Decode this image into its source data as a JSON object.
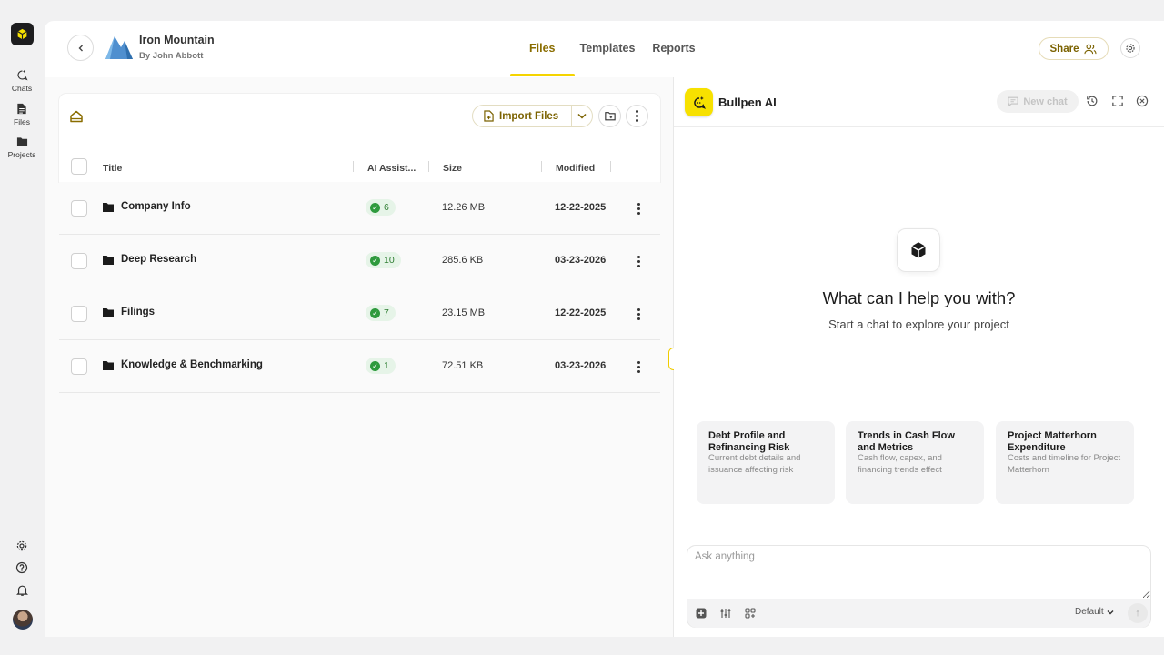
{
  "rail": {
    "items": [
      {
        "label": "Chats",
        "icon": "chat-sparkle-icon"
      },
      {
        "label": "Files",
        "icon": "file-icon"
      },
      {
        "label": "Projects",
        "icon": "folder-icon"
      }
    ],
    "bottom_icons": [
      "settings-icon",
      "help-icon",
      "bell-icon",
      "avatar"
    ]
  },
  "header": {
    "project_title": "Iron Mountain",
    "project_owner": "By John Abbott",
    "tabs": [
      {
        "label": "Files",
        "active": true
      },
      {
        "label": "Templates",
        "active": false
      },
      {
        "label": "Reports",
        "active": false
      }
    ],
    "share_label": "Share"
  },
  "files": {
    "import_label": "Import Files",
    "columns": {
      "title": "Title",
      "ai": "AI Assist...",
      "size": "Size",
      "modified": "Modified"
    },
    "rows": [
      {
        "name": "Company Info",
        "ai_count": "6",
        "size": "12.26 MB",
        "modified": "12-22-2025"
      },
      {
        "name": "Deep Research",
        "ai_count": "10",
        "size": "285.6 KB",
        "modified": "03-23-2026"
      },
      {
        "name": "Filings",
        "ai_count": "7",
        "size": "23.15 MB",
        "modified": "12-22-2025"
      },
      {
        "name": "Knowledge & Benchmarking",
        "ai_count": "1",
        "size": "72.51 KB",
        "modified": "03-23-2026"
      }
    ]
  },
  "ai": {
    "title": "Bullpen AI",
    "new_chat_label": "New chat",
    "hero_title": "What can I help you with?",
    "hero_subtitle": "Start a chat to explore your project",
    "suggestions": [
      {
        "title": "Debt Profile and Refinancing Risk",
        "desc": "Current debt details and issuance affecting risk"
      },
      {
        "title": "Trends in Cash Flow and Metrics",
        "desc": "Cash flow, capex, and financing trends effect"
      },
      {
        "title": "Project Matterhorn Expenditure",
        "desc": "Costs and timeline for Project Matterhorn"
      }
    ],
    "composer_placeholder": "Ask anything",
    "model_label": "Default",
    "colors": {
      "accent": "#f7e100",
      "accent_text": "#7b6200",
      "success": "#2e9a3d"
    }
  }
}
